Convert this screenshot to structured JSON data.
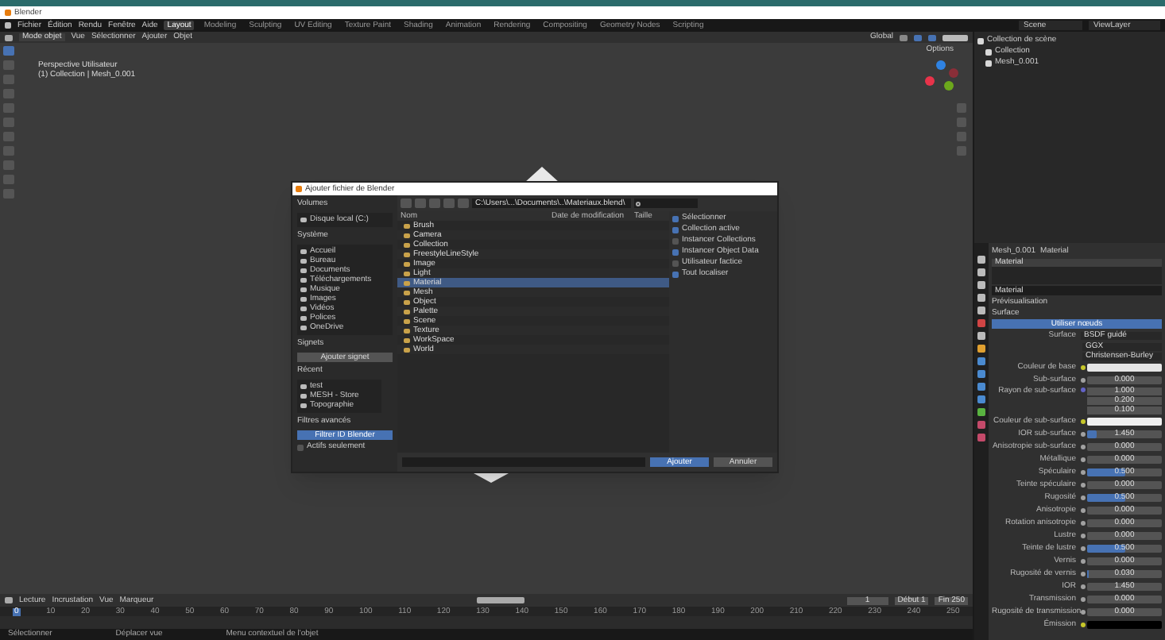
{
  "window": {
    "title": "Blender"
  },
  "menu": [
    "Fichier",
    "Édition",
    "Rendu",
    "Fenêtre",
    "Aide"
  ],
  "workspaces": [
    {
      "label": "Layout",
      "selected": true
    },
    {
      "label": "Modeling",
      "selected": false
    },
    {
      "label": "Sculpting",
      "selected": false
    },
    {
      "label": "UV Editing",
      "selected": false
    },
    {
      "label": "Texture Paint",
      "selected": false
    },
    {
      "label": "Shading",
      "selected": false
    },
    {
      "label": "Animation",
      "selected": false
    },
    {
      "label": "Rendering",
      "selected": false
    },
    {
      "label": "Compositing",
      "selected": false
    },
    {
      "label": "Geometry Nodes",
      "selected": false
    },
    {
      "label": "Scripting",
      "selected": false
    }
  ],
  "scene": {
    "name": "Scene",
    "view_layer": "ViewLayer"
  },
  "viewport": {
    "mode": "Mode objet",
    "menu": [
      "Vue",
      "Sélectionner",
      "Ajouter",
      "Objet"
    ],
    "orientation": "Global",
    "options": "Options",
    "info": [
      "Perspective Utilisateur",
      "(1) Collection | Mesh_0.001"
    ]
  },
  "outliner": {
    "items": [
      {
        "label": "Collection de scène",
        "children": [
          {
            "label": "Collection"
          },
          {
            "label": "Mesh_0.001"
          }
        ]
      }
    ]
  },
  "dialog": {
    "title": "Ajouter fichier de Blender",
    "volumes": {
      "title": "Volumes",
      "items": [
        "Disque local (C:)"
      ]
    },
    "system": {
      "title": "Système",
      "items": [
        "Accueil",
        "Bureau",
        "Documents",
        "Téléchargements",
        "Musique",
        "Images",
        "Vidéos",
        "Polices",
        "OneDrive"
      ]
    },
    "bookmarks": {
      "title": "Signets",
      "button": "Ajouter signet"
    },
    "recent": {
      "title": "Récent",
      "items": [
        "test",
        "MESH - Store",
        "Topographie"
      ]
    },
    "filters": {
      "title": "Filtres avancés",
      "button": "Filtrer ID Blender",
      "checkbox": {
        "label": "Actifs seulement",
        "checked": false
      }
    },
    "path": "C:\\Users\\...\\Documents\\..\\Materiaux.blend\\",
    "columns": [
      "Nom",
      "Date de modification",
      "Taille"
    ],
    "files": [
      {
        "name": "Brush",
        "selected": false
      },
      {
        "name": "Camera",
        "selected": false
      },
      {
        "name": "Collection",
        "selected": false
      },
      {
        "name": "FreestyleLineStyle",
        "selected": false
      },
      {
        "name": "Image",
        "selected": false
      },
      {
        "name": "Light",
        "selected": false
      },
      {
        "name": "Material",
        "selected": true
      },
      {
        "name": "Mesh",
        "selected": false
      },
      {
        "name": "Object",
        "selected": false
      },
      {
        "name": "Palette",
        "selected": false
      },
      {
        "name": "Scene",
        "selected": false
      },
      {
        "name": "Texture",
        "selected": false
      },
      {
        "name": "WorkSpace",
        "selected": false
      },
      {
        "name": "World",
        "selected": false
      }
    ],
    "options": [
      {
        "label": "Sélectionner",
        "checked": true
      },
      {
        "label": "Collection active",
        "checked": true
      },
      {
        "label": "Instancer Collections",
        "checked": false
      },
      {
        "label": "Instancer Object Data",
        "checked": true
      },
      {
        "label": "Utilisateur factice",
        "checked": false
      },
      {
        "label": "Tout localiser",
        "checked": true
      }
    ],
    "confirm": "Ajouter",
    "cancel": "Annuler"
  },
  "properties": {
    "object": "Mesh_0.001",
    "material": "Material",
    "slot": "Material",
    "material_field": "Material",
    "sections": [
      "Prévisualisation",
      "Surface"
    ],
    "use_nodes": "Utiliser nœuds",
    "surface_label": "Surface",
    "surface_value": "BSDF guidé",
    "distribution": "GGX",
    "subsurface_method": "Christensen-Burley",
    "rows": [
      {
        "kind": "color",
        "label": "Couleur de base",
        "color": "#e6e6e6"
      },
      {
        "kind": "number",
        "label": "Sub-surface",
        "value": "0.000"
      },
      {
        "kind": "vector",
        "label": "Rayon de sub-surface",
        "values": [
          "1.000",
          "0.200",
          "0.100"
        ]
      },
      {
        "kind": "color",
        "label": "Couleur de sub-surface",
        "color": "#f0f0f0"
      },
      {
        "kind": "value",
        "label": "IOR sub-surface",
        "value": "1.450",
        "level": 0.12
      },
      {
        "kind": "number",
        "label": "Anisotropie sub-surface",
        "value": "0.000"
      },
      {
        "kind": "number",
        "label": "Métallique",
        "value": "0.000"
      },
      {
        "kind": "value",
        "label": "Spéculaire",
        "value": "0.500",
        "level": 0.5
      },
      {
        "kind": "number",
        "label": "Teinte spéculaire",
        "value": "0.000"
      },
      {
        "kind": "value",
        "label": "Rugosité",
        "value": "0.500",
        "level": 0.5
      },
      {
        "kind": "number",
        "label": "Anisotropie",
        "value": "0.000"
      },
      {
        "kind": "number",
        "label": "Rotation anisotropie",
        "value": "0.000"
      },
      {
        "kind": "number",
        "label": "Lustre",
        "value": "0.000"
      },
      {
        "kind": "value",
        "label": "Teinte de lustre",
        "value": "0.500",
        "level": 0.5
      },
      {
        "kind": "number",
        "label": "Vernis",
        "value": "0.000"
      },
      {
        "kind": "value",
        "label": "Rugosité de vernis",
        "value": "0.030",
        "level": 0.03
      },
      {
        "kind": "number",
        "label": "IOR",
        "value": "1.450"
      },
      {
        "kind": "number",
        "label": "Transmission",
        "value": "0.000"
      },
      {
        "kind": "number",
        "label": "Rugosité de transmission",
        "value": "0.000"
      },
      {
        "kind": "color",
        "label": "Émission",
        "color": "#000000"
      }
    ]
  },
  "timeline": {
    "menu": [
      "Lecture",
      "Incrustation",
      "Vue",
      "Marqueur"
    ],
    "current": "1",
    "start": "Début",
    "start_value": "1",
    "end": "Fin",
    "end_value": "250",
    "ticks": [
      "0",
      "10",
      "20",
      "30",
      "40",
      "50",
      "60",
      "70",
      "80",
      "90",
      "100",
      "110",
      "120",
      "130",
      "140",
      "150",
      "160",
      "170",
      "180",
      "190",
      "200",
      "210",
      "220",
      "230",
      "240",
      "250"
    ]
  },
  "status": [
    "Sélectionner",
    "Déplacer vue",
    "Menu contextuel de l'objet"
  ]
}
